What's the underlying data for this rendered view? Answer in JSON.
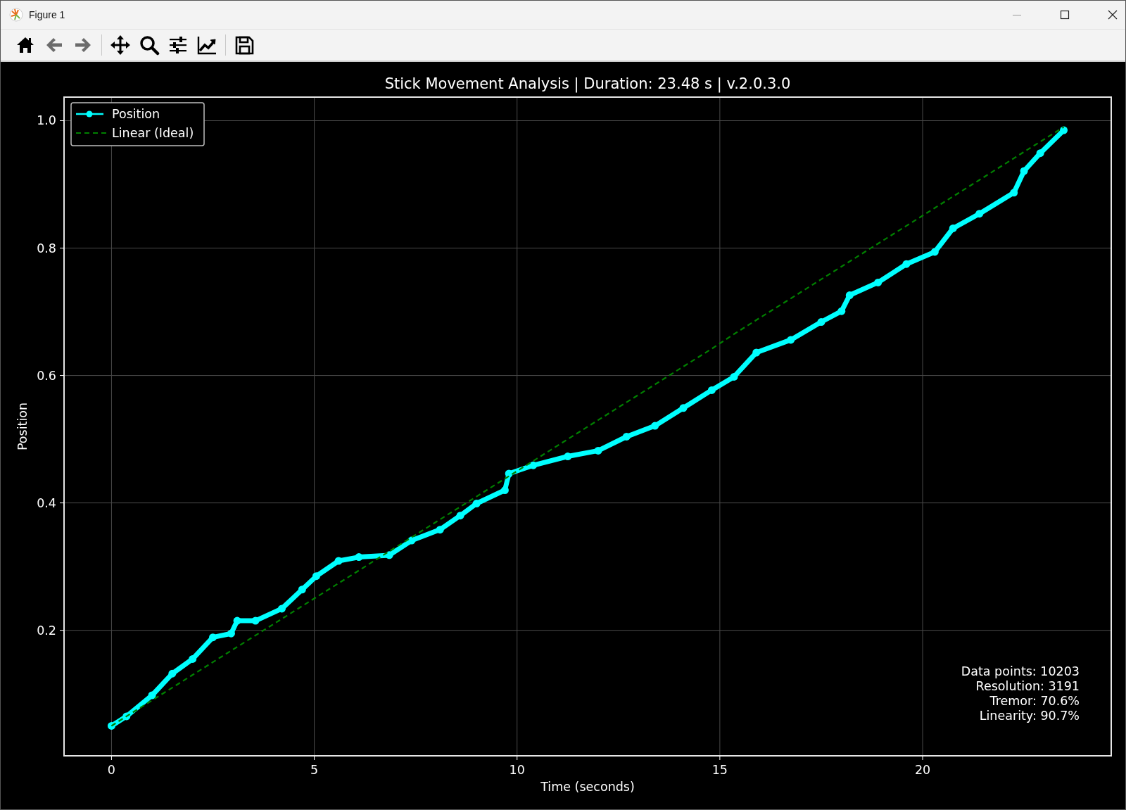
{
  "window": {
    "title": "Figure 1"
  },
  "toolbar": [
    {
      "kind": "home",
      "disabled": false
    },
    {
      "kind": "back",
      "disabled": true
    },
    {
      "kind": "forward",
      "disabled": true
    },
    {
      "kind": "pan",
      "disabled": false
    },
    {
      "kind": "zoom",
      "disabled": false
    },
    {
      "kind": "sliders",
      "disabled": false
    },
    {
      "kind": "chart",
      "disabled": false
    },
    {
      "kind": "save",
      "disabled": false
    }
  ],
  "figure": {
    "chart_data": {
      "type": "line",
      "title": "Stick Movement Analysis | Duration: 23.48 s | v.2.0.3.0",
      "xlabel": "Time (seconds)",
      "ylabel": "Position",
      "grid": true,
      "legend": true,
      "xlim": [
        -1.17,
        24.65
      ],
      "ylim": [
        0.003,
        1.037
      ],
      "xticks": [
        0,
        5,
        10,
        15,
        20
      ],
      "yticks": [
        {
          "value": 0.2,
          "label": "0.2"
        },
        {
          "value": 0.4,
          "label": "0.4"
        },
        {
          "value": 0.6,
          "label": "0.6"
        },
        {
          "value": 0.8,
          "label": "0.8"
        },
        {
          "value": 1.0,
          "label": "1.0"
        }
      ],
      "x": [
        0,
        0.37,
        1.0,
        1.5,
        2.0,
        2.5,
        2.95,
        3.1,
        3.55,
        4.2,
        4.7,
        5.05,
        5.6,
        6.1,
        6.85,
        7.4,
        8.1,
        8.6,
        9.0,
        9.7,
        9.8,
        10.4,
        11.25,
        12.0,
        12.7,
        13.4,
        14.1,
        14.8,
        15.35,
        15.9,
        16.75,
        17.5,
        18.0,
        18.2,
        18.9,
        19.6,
        20.3,
        20.75,
        21.4,
        22.25,
        22.5,
        22.9,
        23.48
      ],
      "series": [
        {
          "name": "Position",
          "color": "#00ffff",
          "line_style": "solid",
          "marker": "o",
          "values": [
            0.05,
            0.065,
            0.098,
            0.132,
            0.155,
            0.189,
            0.195,
            0.215,
            0.215,
            0.234,
            0.264,
            0.285,
            0.309,
            0.315,
            0.318,
            0.341,
            0.358,
            0.38,
            0.399,
            0.42,
            0.446,
            0.459,
            0.473,
            0.482,
            0.504,
            0.521,
            0.549,
            0.577,
            0.598,
            0.636,
            0.656,
            0.684,
            0.701,
            0.726,
            0.746,
            0.775,
            0.794,
            0.831,
            0.854,
            0.887,
            0.921,
            0.949,
            0.985
          ]
        },
        {
          "name": "Linear (Ideal)",
          "color": "#008000",
          "line_style": "dashed",
          "values": [
            0.05,
            0.065,
            0.09,
            0.11,
            0.13,
            0.15,
            0.168,
            0.174,
            0.192,
            0.218,
            0.238,
            0.252,
            0.274,
            0.294,
            0.324,
            0.346,
            0.374,
            0.394,
            0.41,
            0.438,
            0.442,
            0.466,
            0.5,
            0.53,
            0.558,
            0.586,
            0.614,
            0.642,
            0.665,
            0.687,
            0.721,
            0.751,
            0.771,
            0.779,
            0.807,
            0.835,
            0.863,
            0.881,
            0.907,
            0.941,
            0.951,
            0.967,
            0.99
          ]
        }
      ]
    },
    "stats": [
      "Data points: 10203",
      "Resolution: 3191",
      "Tremor: 70.6%",
      "Linearity: 90.7%"
    ]
  }
}
